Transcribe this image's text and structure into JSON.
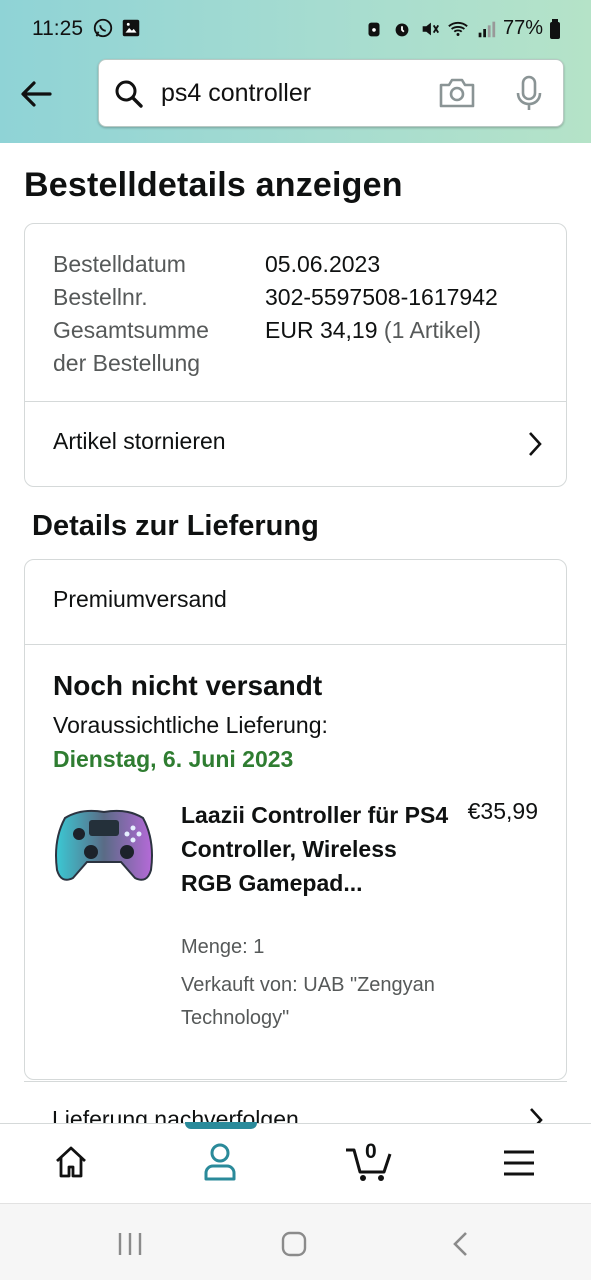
{
  "status_bar": {
    "time": "11:25",
    "battery": "77%"
  },
  "search": {
    "query": "ps4 controller"
  },
  "page": {
    "title": "Bestelldetails anzeigen"
  },
  "order": {
    "date_label": "Bestelldatum",
    "date_value": "05.06.2023",
    "number_label": "Bestellnr.",
    "number_value": "302-5597508-1617942",
    "total_label_1": "Gesamtsumme",
    "total_label_2": "der Bestellung",
    "total_value": "EUR 34,19",
    "total_items": "(1 Artikel)",
    "cancel_label": "Artikel stornieren"
  },
  "delivery": {
    "heading": "Details zur Lieferung",
    "method": "Premiumversand",
    "status": "Noch nicht versandt",
    "estimate_label": "Voraussichtliche Lieferung:",
    "estimate_date": "Dienstag, 6. Juni 2023",
    "track_label": "Lieferung nachverfolgen"
  },
  "product": {
    "title": "Laazii Controller für PS4 Controller, Wireless RGB Gamepad...",
    "price": "€35,99",
    "quantity": "Menge: 1",
    "seller": "Verkauft von: UAB \"Zengyan Technology\""
  },
  "bottom_nav": {
    "items": [
      "home-icon",
      "account-icon",
      "cart-icon",
      "menu-icon"
    ],
    "active": "account-icon",
    "cart_count": "0"
  },
  "colors": {
    "header_gradient_start": "#8fd3d6",
    "header_gradient_end": "#b5e3c8",
    "delivery_date_green": "#2f7d31",
    "active_tab_teal": "#2a8a9a"
  }
}
